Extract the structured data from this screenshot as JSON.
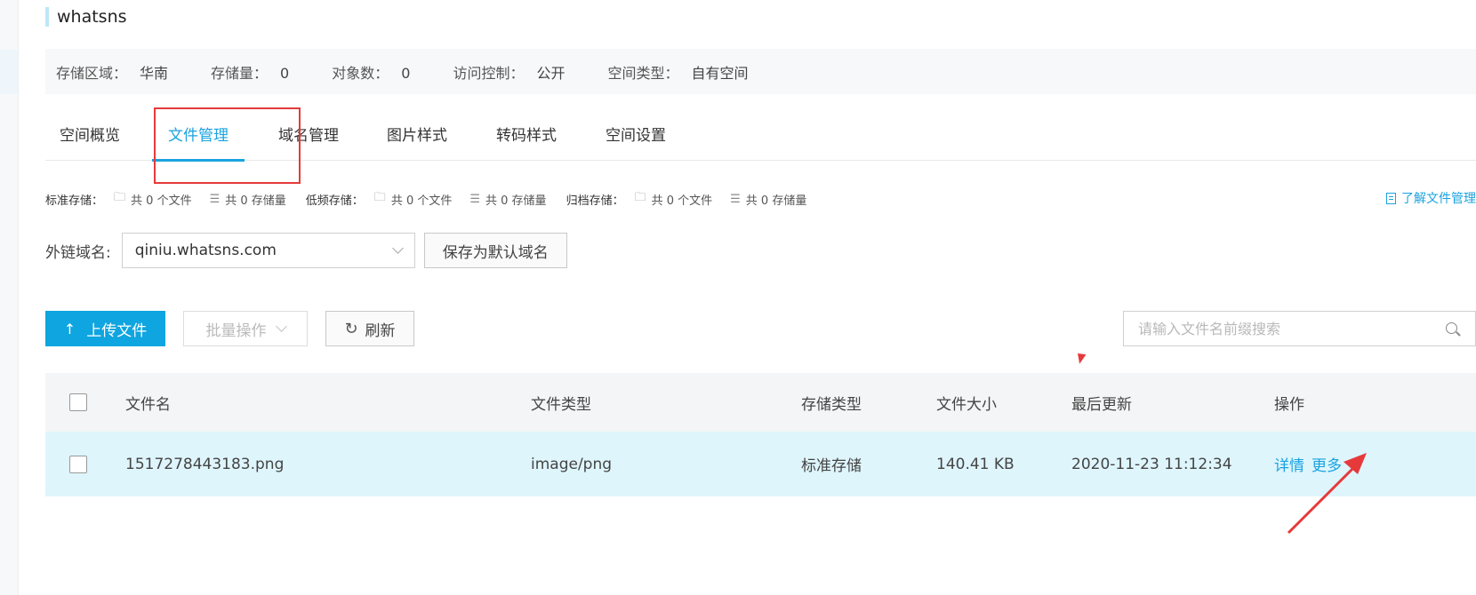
{
  "bucket": {
    "name": "whatsns"
  },
  "info": [
    {
      "label": "存储区域：",
      "value": "华南"
    },
    {
      "label": "存储量：",
      "value": "0"
    },
    {
      "label": "对象数：",
      "value": "0"
    },
    {
      "label": "访问控制：",
      "value": "公开"
    },
    {
      "label": "空间类型：",
      "value": "自有空间"
    }
  ],
  "tabs": [
    {
      "label": "空间概览",
      "active": false
    },
    {
      "label": "文件管理",
      "active": true
    },
    {
      "label": "域名管理",
      "active": false
    },
    {
      "label": "图片样式",
      "active": false
    },
    {
      "label": "转码样式",
      "active": false
    },
    {
      "label": "空间设置",
      "active": false
    }
  ],
  "storage_stats": [
    {
      "label": "标准存储：",
      "files": "共 0 个文件",
      "size": "共 0 存储量"
    },
    {
      "label": "低频存储：",
      "files": "共 0 个文件",
      "size": "共 0 存储量"
    },
    {
      "label": "归档存储：",
      "files": "共 0 个文件",
      "size": "共 0 存储量"
    }
  ],
  "learn_link": "了解文件管理",
  "domain": {
    "label": "外链域名:",
    "value": "qiniu.whatsns.com",
    "save_default_label": "保存为默认域名"
  },
  "actions": {
    "upload_label": "上传文件",
    "batch_label": "批量操作",
    "refresh_label": "刷新",
    "search_placeholder": "请输入文件名前缀搜索"
  },
  "table": {
    "headers": {
      "name": "文件名",
      "type": "文件类型",
      "storage": "存储类型",
      "size": "文件大小",
      "updated": "最后更新",
      "ops": "操作"
    },
    "rows": [
      {
        "name": "1517278443183.png",
        "type": "image/png",
        "storage": "标准存储",
        "size": "140.41 KB",
        "updated": "2020-11-23 11:12:34",
        "op_detail": "详情",
        "op_more": "更多"
      }
    ]
  },
  "colors": {
    "accent": "#1aa3df",
    "upload_button": "#0ea5e0",
    "selected_row": "#def5fc",
    "annotation": "#e63a3a"
  },
  "icons": {
    "folder": "folder-icon",
    "list": "list-icon",
    "document": "document-icon",
    "upload": "arrow-up-icon",
    "refresh": "refresh-icon",
    "search": "search-icon",
    "dropdown": "chevron-down-icon"
  }
}
